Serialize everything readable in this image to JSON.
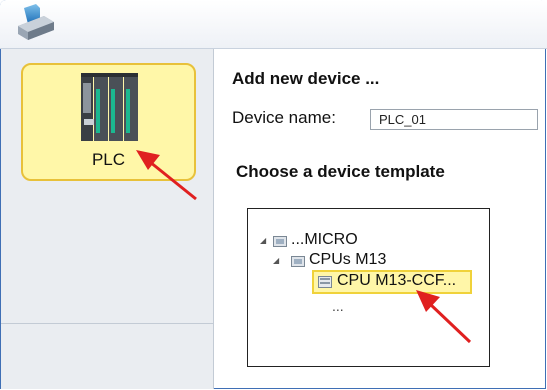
{
  "window": {
    "icon": "tia-portal-app-icon"
  },
  "sidebar": {
    "tile": {
      "label": "PLC",
      "icon": "plc-device-icon",
      "highlight_color": "#fff7a8"
    }
  },
  "main": {
    "heading": "Add new device ...",
    "device_name_label": "Device name:",
    "device_name_value": "PLC_01",
    "template_heading": "Choose a device template",
    "tree": {
      "root": {
        "label": "...MICRO",
        "expanded": true,
        "icon": "folder-icon"
      },
      "child": {
        "label": "CPUs M13",
        "expanded": true,
        "icon": "folder-icon"
      },
      "leaf": {
        "label": "CPU M13-CCF...",
        "selected": true,
        "icon": "cpu-module-icon"
      },
      "more": "..."
    }
  },
  "annotations": {
    "arrow_color": "#e02020"
  }
}
